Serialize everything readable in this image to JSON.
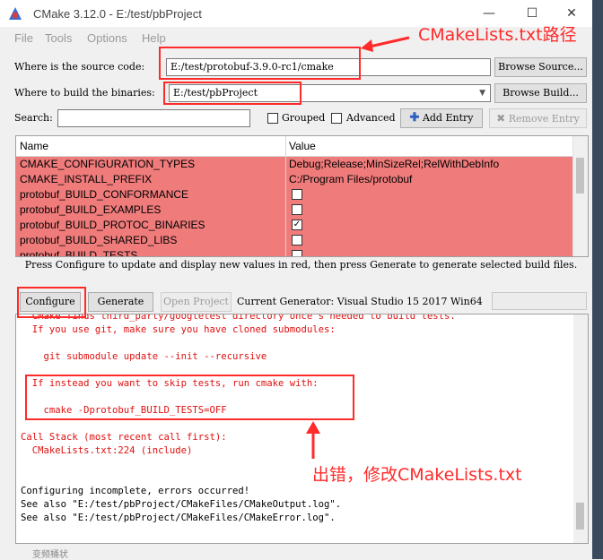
{
  "window": {
    "title": "CMake 3.12.0 - E:/test/pbProject",
    "minimize_glyph": "—",
    "maximize_glyph": "☐",
    "close_glyph": "✕"
  },
  "menu": {
    "items": [
      {
        "label": "File"
      },
      {
        "label": "Tools"
      },
      {
        "label": "Options"
      },
      {
        "label": "Help"
      }
    ]
  },
  "source": {
    "label": "Where is the source code:",
    "value": "E:/test/protobuf-3.9.0-rc1/cmake",
    "browse_label": "Browse Source..."
  },
  "build": {
    "label": "Where to build the binaries:",
    "value": "E:/test/pbProject",
    "browse_label": "Browse Build..."
  },
  "search": {
    "label": "Search:",
    "value": "",
    "grouped_label": "Grouped",
    "advanced_label": "Advanced",
    "add_entry_label": "Add Entry",
    "remove_entry_label": "Remove Entry"
  },
  "table": {
    "columns": [
      "Name",
      "Value"
    ],
    "rows": [
      {
        "name": "CMAKE_CONFIGURATION_TYPES",
        "value": "Debug;Release;MinSizeRel;RelWithDebInfo",
        "type": "text"
      },
      {
        "name": "CMAKE_INSTALL_PREFIX",
        "value": "C:/Program Files/protobuf",
        "type": "text"
      },
      {
        "name": "protobuf_BUILD_CONFORMANCE",
        "value": "",
        "type": "checkbox",
        "checked": false
      },
      {
        "name": "protobuf_BUILD_EXAMPLES",
        "value": "",
        "type": "checkbox",
        "checked": false
      },
      {
        "name": "protobuf_BUILD_PROTOC_BINARIES",
        "value": "",
        "type": "checkbox",
        "checked": true
      },
      {
        "name": "protobuf_BUILD_SHARED_LIBS",
        "value": "",
        "type": "checkbox",
        "checked": false
      },
      {
        "name": "protobuf_BUILD_TESTS",
        "value": "",
        "type": "checkbox",
        "checked": false
      }
    ],
    "check_glyph": "✓"
  },
  "info_text": "Press Configure to update and display new values in red, then press Generate to generate selected build files.",
  "actions": {
    "configure_label": "Configure",
    "generate_label": "Generate",
    "open_project_label": "Open Project",
    "generator_text": "Current Generator: Visual Studio 15 2017 Win64"
  },
  "output": {
    "lines": [
      {
        "text": "  CMake finds third_party/googletest directory once s needed to build tests.",
        "red": true
      },
      {
        "text": "  If you use git, make sure you have cloned submodules:",
        "red": true
      },
      {
        "text": "",
        "red": true
      },
      {
        "text": "    git submodule update --init --recursive",
        "red": true
      },
      {
        "text": "",
        "red": true
      },
      {
        "text": "  If instead you want to skip tests, run cmake with:",
        "red": true
      },
      {
        "text": "",
        "red": true
      },
      {
        "text": "    cmake -Dprotobuf_BUILD_TESTS=OFF",
        "red": true
      },
      {
        "text": "",
        "red": true
      },
      {
        "text": "Call Stack (most recent call first):",
        "red": true
      },
      {
        "text": "  CMakeLists.txt:224 (include)",
        "red": true
      },
      {
        "text": "",
        "red": false
      },
      {
        "text": "",
        "red": false
      },
      {
        "text": "Configuring incomplete, errors occurred!",
        "red": false
      },
      {
        "text": "See also \"E:/test/pbProject/CMakeFiles/CMakeOutput.log\".",
        "red": false
      },
      {
        "text": "See also \"E:/test/pbProject/CMakeFiles/CMakeError.log\".",
        "red": false
      }
    ]
  },
  "annotations": {
    "cmakelists_path": "CMakeLists.txt路径",
    "error_note": "出错，修改CMakeLists.txt",
    "color": "#ff2a2a"
  },
  "status_text": "变频桶状"
}
